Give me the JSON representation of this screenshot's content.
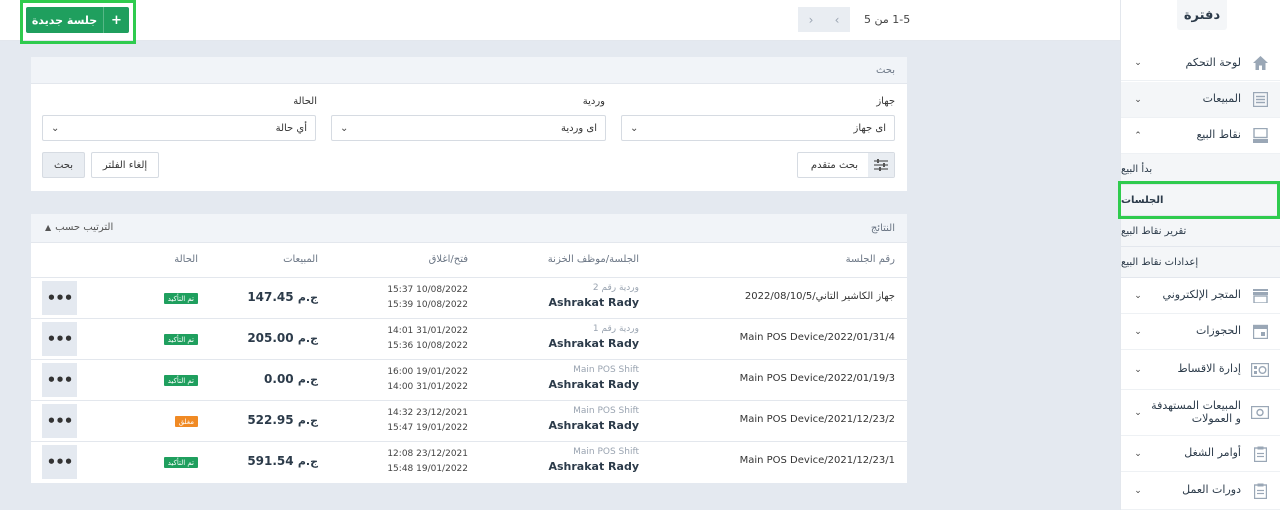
{
  "topbar": {
    "new_session_label": "جلسة جديدة",
    "new_session_icon": "+",
    "pager_text": "1-5 من 5",
    "prev_icon": "‹",
    "next_icon": "›"
  },
  "search": {
    "title": "بحث",
    "device_label": "جهاز",
    "device_value": "اى جهاز",
    "shift_label": "وردية",
    "shift_value": "اى وردية",
    "status_label": "الحالة",
    "status_value": "أي حالة",
    "advanced_label": "بحث متقدم",
    "reset_label": "إلغاء الفلتر",
    "search_button": "بحث"
  },
  "results": {
    "title": "النتائج",
    "sort_label": "الترتيب حسب",
    "columns": [
      "رقم الجلسة",
      "الجلسة/موظف الخزنة",
      "فتح/اغلاق",
      "المبيعات",
      "الحالة"
    ],
    "rows": [
      {
        "session": "جهاز الكاشير التاني/2022/08/10/5",
        "shift": "وردية رقم 2",
        "cashier": "Ashrakat Rady",
        "opened": "15:37 10/08/2022",
        "closed": "15:39 10/08/2022",
        "sales": "147.45",
        "currency": "ج.م",
        "status": "تم التأكيد",
        "status_type": "confirmed"
      },
      {
        "session": "Main POS Device/2022/01/31/4",
        "shift": "وردية رقم 1",
        "cashier": "Ashrakat Rady",
        "opened": "14:01 31/01/2022",
        "closed": "15:36 10/08/2022",
        "sales": "205.00",
        "currency": "ج.م",
        "status": "تم التأكيد",
        "status_type": "confirmed"
      },
      {
        "session": "Main POS Device/2022/01/19/3",
        "shift": "Main POS Shift",
        "cashier": "Ashrakat Rady",
        "opened": "16:00 19/01/2022",
        "closed": "14:00 31/01/2022",
        "sales": "0.00",
        "currency": "ج.م",
        "status": "تم التأكيد",
        "status_type": "confirmed"
      },
      {
        "session": "Main POS Device/2021/12/23/2",
        "shift": "Main POS Shift",
        "cashier": "Ashrakat Rady",
        "opened": "14:32 23/12/2021",
        "closed": "15:47 19/01/2022",
        "sales": "522.95",
        "currency": "ج.م",
        "status": "مغلق",
        "status_type": "closed"
      },
      {
        "session": "Main POS Device/2021/12/23/1",
        "shift": "Main POS Shift",
        "cashier": "Ashrakat Rady",
        "opened": "12:08 23/12/2021",
        "closed": "15:48 19/01/2022",
        "sales": "591.54",
        "currency": "ج.م",
        "status": "تم التأكيد",
        "status_type": "confirmed"
      }
    ]
  },
  "colors": {
    "confirmed": "#1f9f5e",
    "closed": "#f08a24",
    "highlight": "#2fcb4e",
    "icon": "#9aa7b6"
  },
  "sidebar": {
    "logo_text": "دفترة",
    "items": [
      {
        "label": "لوحة التحكم",
        "icon": "home-icon"
      },
      {
        "label": "المبيعات",
        "icon": "list-icon"
      },
      {
        "label": "نقاط البيع",
        "icon": "monitor-icon"
      },
      {
        "label": "المتجر الإلكتروني",
        "icon": "store-icon"
      },
      {
        "label": "الحجوزات",
        "icon": "calendar-icon"
      },
      {
        "label": "إدارة الاقساط",
        "icon": "installments-icon"
      },
      {
        "label": "المبيعات المستهدفة و العمولات",
        "icon": "money-icon"
      },
      {
        "label": "أوامر الشغل",
        "icon": "clipboard-icon"
      },
      {
        "label": "دورات العمل",
        "icon": "clipboard-icon"
      }
    ],
    "pos_sub": [
      "بدأ البيع",
      "الجلسات",
      "تقرير نقاط البيع",
      "إعدادات نقاط البيع"
    ]
  }
}
